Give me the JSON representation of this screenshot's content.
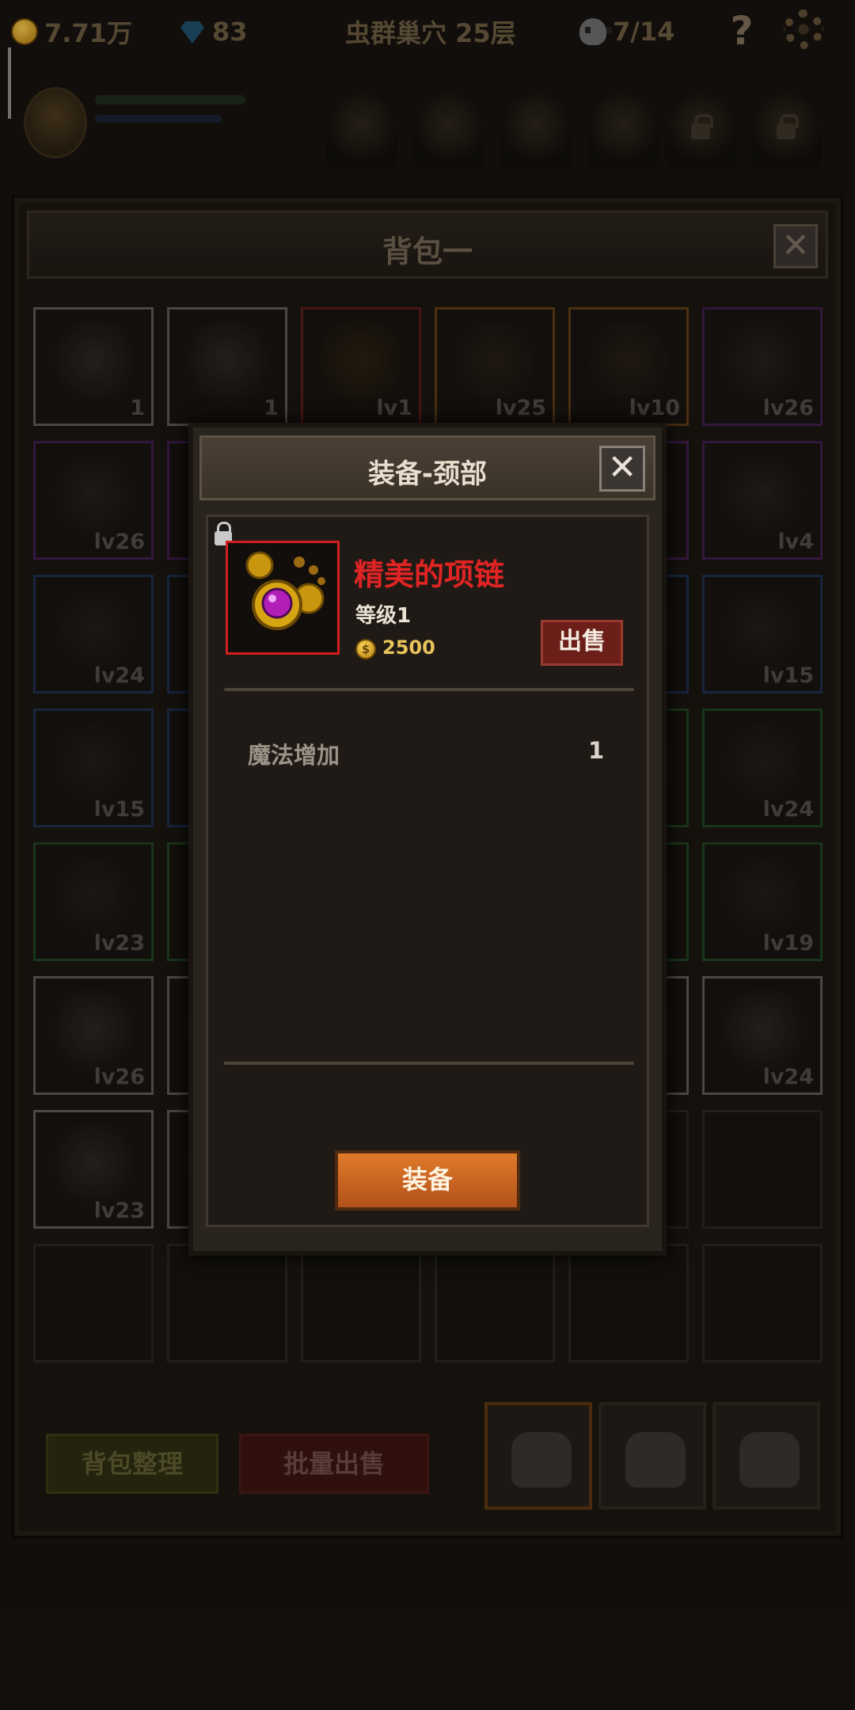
{
  "hud": {
    "gold": "7.71万",
    "gems": "83",
    "location": "虫群巢穴 25层",
    "kills": "7/14",
    "help": "?"
  },
  "bag": {
    "title": "背包一",
    "close": "✕",
    "cells": [
      {
        "lv": "1",
        "quality": "white"
      },
      {
        "lv": "1",
        "quality": "white"
      },
      {
        "lv": "lv1",
        "quality": "red"
      },
      {
        "lv": "lv25",
        "quality": "orange"
      },
      {
        "lv": "lv10",
        "quality": "orange"
      },
      {
        "lv": "lv26",
        "quality": "purple"
      },
      {
        "lv": "lv26",
        "quality": "purple"
      },
      {
        "lv": "",
        "quality": "purple"
      },
      {
        "lv": "",
        "quality": "empty"
      },
      {
        "lv": "",
        "quality": "empty"
      },
      {
        "lv": "",
        "quality": "purple"
      },
      {
        "lv": "lv4",
        "quality": "purple"
      },
      {
        "lv": "lv24",
        "quality": "blue"
      },
      {
        "lv": "",
        "quality": "blue"
      },
      {
        "lv": "",
        "quality": "empty"
      },
      {
        "lv": "",
        "quality": "empty"
      },
      {
        "lv": "",
        "quality": "blue"
      },
      {
        "lv": "lv15",
        "quality": "blue"
      },
      {
        "lv": "lv15",
        "quality": "blue"
      },
      {
        "lv": "",
        "quality": "blue"
      },
      {
        "lv": "",
        "quality": "empty"
      },
      {
        "lv": "",
        "quality": "empty"
      },
      {
        "lv": "",
        "quality": "green"
      },
      {
        "lv": "lv24",
        "quality": "green"
      },
      {
        "lv": "lv23",
        "quality": "green"
      },
      {
        "lv": "",
        "quality": "green"
      },
      {
        "lv": "",
        "quality": "empty"
      },
      {
        "lv": "",
        "quality": "empty"
      },
      {
        "lv": "",
        "quality": "green"
      },
      {
        "lv": "lv19",
        "quality": "green"
      },
      {
        "lv": "lv26",
        "quality": "white"
      },
      {
        "lv": "",
        "quality": "white"
      },
      {
        "lv": "",
        "quality": "empty"
      },
      {
        "lv": "",
        "quality": "empty"
      },
      {
        "lv": "",
        "quality": "white"
      },
      {
        "lv": "lv24",
        "quality": "white"
      },
      {
        "lv": "lv23",
        "quality": "white"
      },
      {
        "lv": "",
        "quality": "white"
      },
      {
        "lv": "",
        "quality": "empty"
      },
      {
        "lv": "",
        "quality": "empty"
      },
      {
        "lv": "",
        "quality": "empty"
      },
      {
        "lv": "",
        "quality": "empty"
      },
      {
        "lv": "",
        "quality": "empty"
      },
      {
        "lv": "",
        "quality": "empty"
      },
      {
        "lv": "",
        "quality": "empty"
      },
      {
        "lv": "",
        "quality": "empty"
      },
      {
        "lv": "",
        "quality": "empty"
      },
      {
        "lv": "",
        "quality": "empty"
      }
    ],
    "sort_label": "背包整理",
    "batch_sell_label": "批量出售"
  },
  "dialog": {
    "title": "装备-颈部",
    "close": "✕",
    "item_name": "精美的项链",
    "item_level": "等级1",
    "coin_symbol": "$",
    "item_price": "2500",
    "sell_label": "出售",
    "stat_name": "魔法增加",
    "stat_value": "1",
    "equip_label": "装备"
  },
  "colors": {
    "rare_name": "#e02424",
    "equip_button": "#d06a22",
    "sell_button": "#6b1f18"
  }
}
